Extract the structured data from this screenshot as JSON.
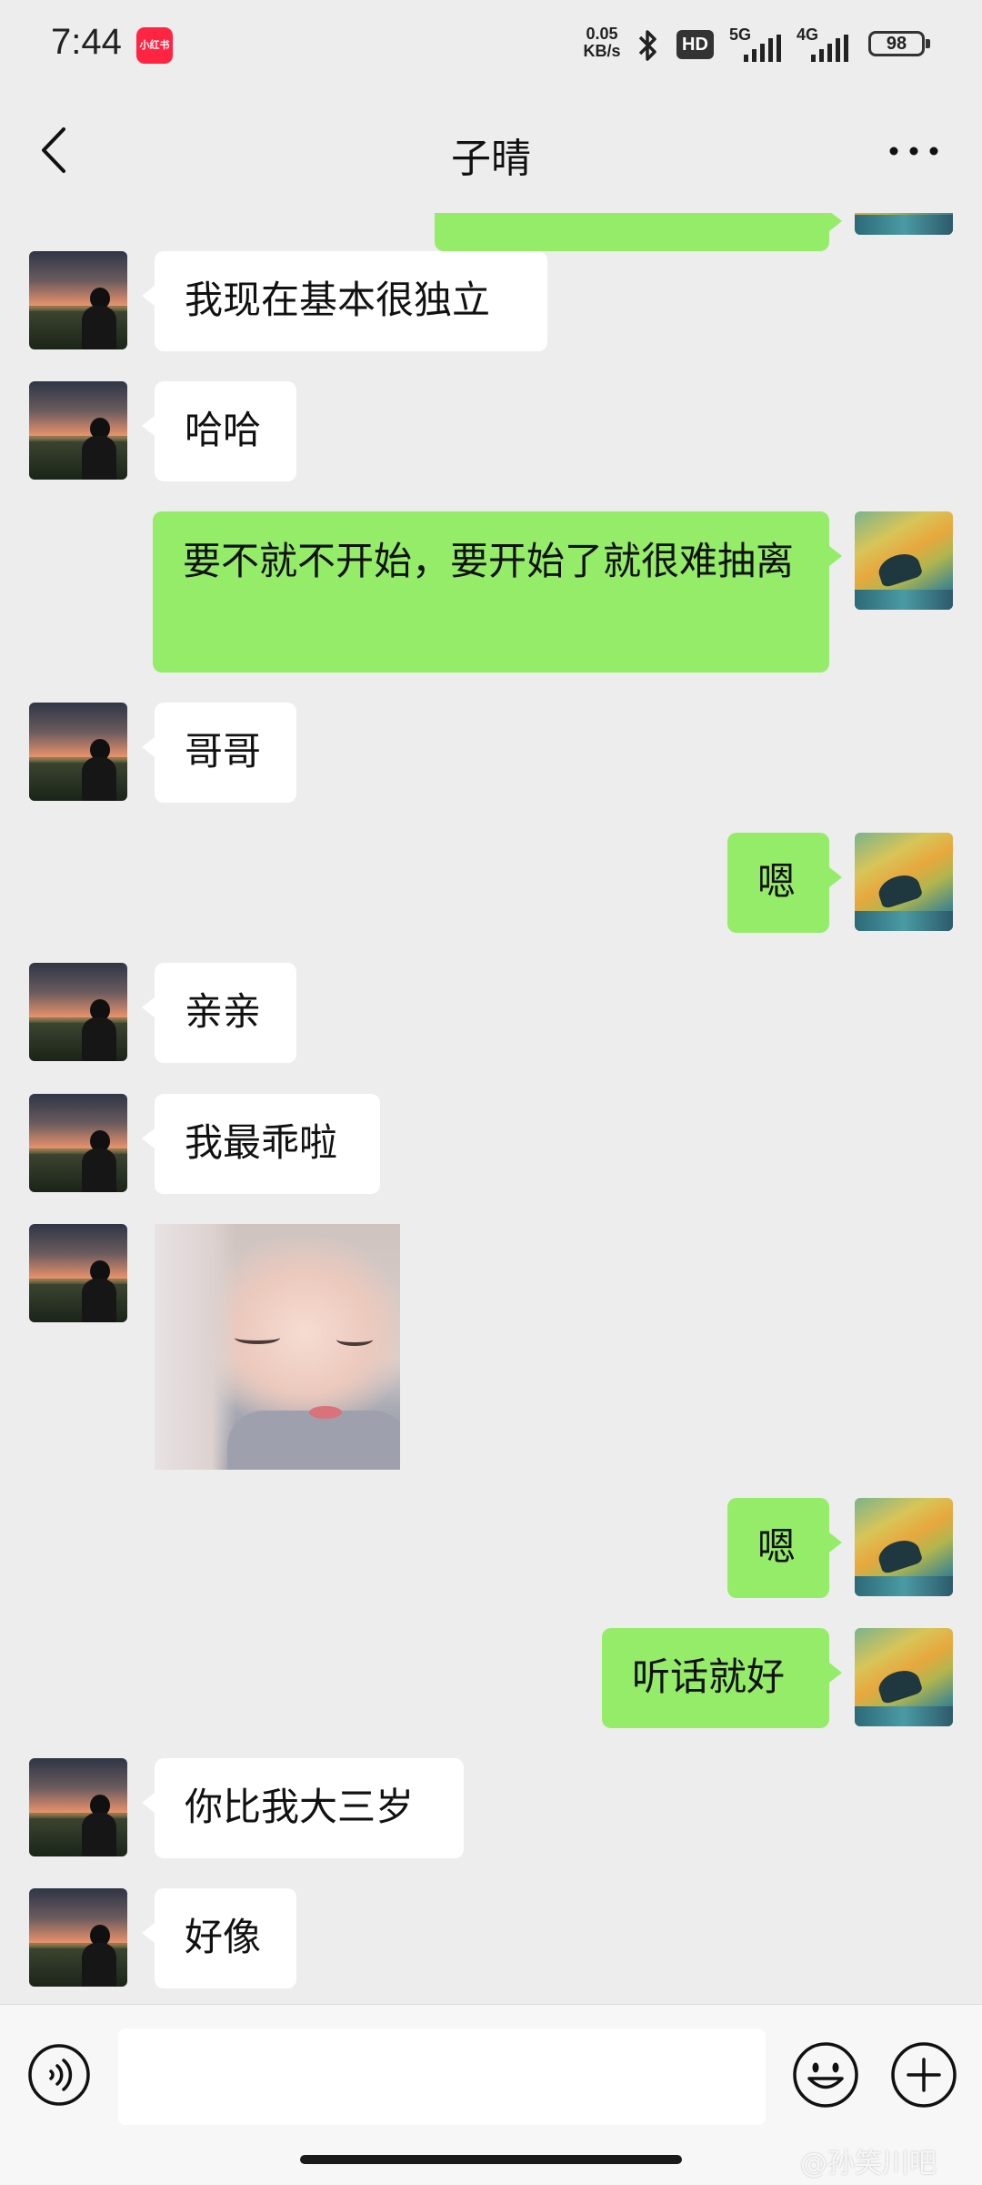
{
  "status_bar": {
    "time": "7:44",
    "app_badge": "小红书",
    "net_speed_value": "0.05",
    "net_speed_unit": "KB/s",
    "hd_badge": "HD",
    "network_1": "5G",
    "network_2": "4G",
    "battery": "98"
  },
  "nav": {
    "title": "子晴"
  },
  "messages": [
    {
      "side": "left",
      "type": "text",
      "text": "我现在基本很独立"
    },
    {
      "side": "left",
      "type": "text",
      "text": "哈哈"
    },
    {
      "side": "right",
      "type": "text",
      "text": "要不就不开始，要开始了就很难抽离"
    },
    {
      "side": "left",
      "type": "text",
      "text": "哥哥"
    },
    {
      "side": "right",
      "type": "text",
      "text": "嗯"
    },
    {
      "side": "left",
      "type": "text",
      "text": "亲亲"
    },
    {
      "side": "left",
      "type": "text",
      "text": "我最乖啦"
    },
    {
      "side": "left",
      "type": "image",
      "text": ""
    },
    {
      "side": "right",
      "type": "text",
      "text": "嗯"
    },
    {
      "side": "right",
      "type": "text",
      "text": "听话就好"
    },
    {
      "side": "left",
      "type": "text",
      "text": "你比我大三岁"
    },
    {
      "side": "left",
      "type": "text",
      "text": "好像"
    }
  ],
  "input": {
    "value": "",
    "placeholder": ""
  },
  "icons": {
    "back": "back-arrow-icon",
    "more": "more-dots-icon",
    "voice": "voice-icon",
    "emoji": "emoji-icon",
    "plus": "plus-icon"
  },
  "colors": {
    "background": "#ededed",
    "incoming_bubble": "#ffffff",
    "outgoing_bubble": "#95ec69",
    "input_bar": "#f7f7f7"
  },
  "watermark": "@孙笑川吧"
}
